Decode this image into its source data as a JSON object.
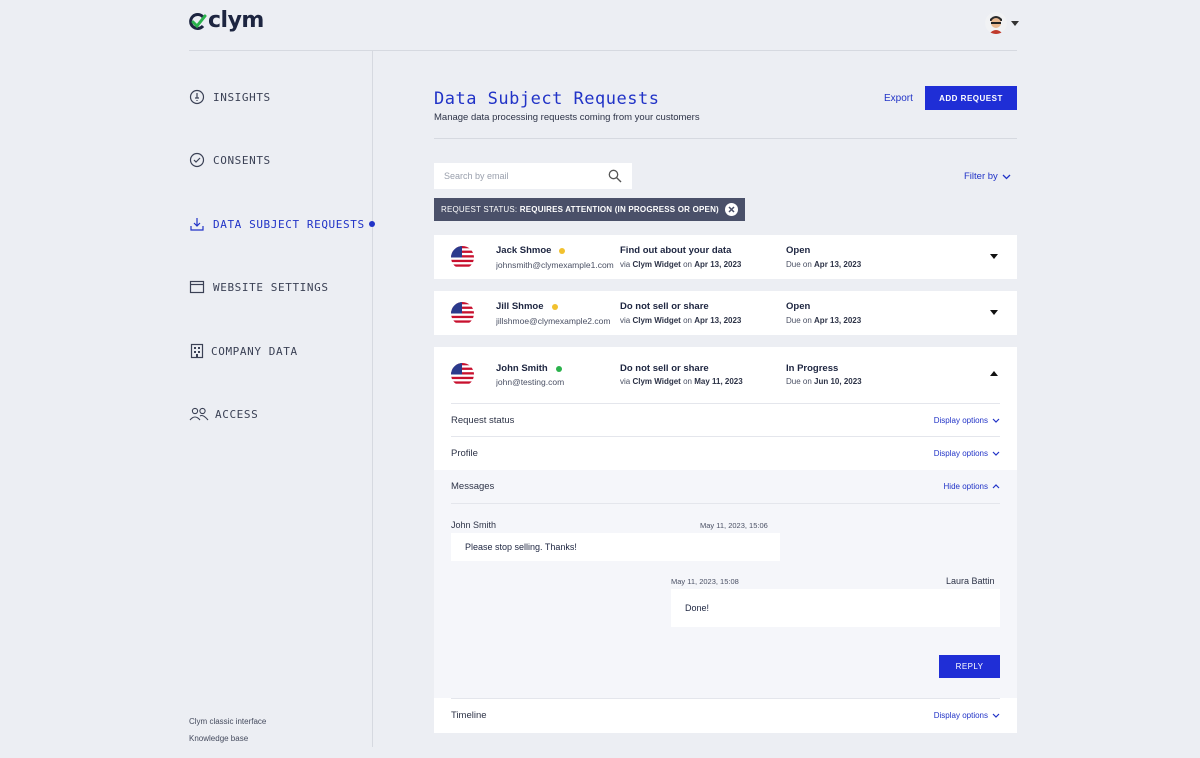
{
  "app": {
    "logo_text": "clym",
    "brand_color": "#1f2ed6"
  },
  "sidebar": {
    "items": [
      {
        "label": "INSIGHTS",
        "icon": "insights-icon"
      },
      {
        "label": "CONSENTS",
        "icon": "check-circle-icon"
      },
      {
        "label": "DATA SUBJECT REQUESTS",
        "icon": "download-icon",
        "active": true
      },
      {
        "label": "WEBSITE SETTINGS",
        "icon": "browser-window-icon"
      },
      {
        "label": "COMPANY DATA",
        "icon": "building-icon"
      },
      {
        "label": "ACCESS",
        "icon": "users-icon"
      }
    ],
    "footer": {
      "classic": "Clym classic interface",
      "kb": "Knowledge base"
    }
  },
  "page": {
    "title": "Data Subject Requests",
    "subtitle": "Manage data processing requests coming from your customers",
    "export_label": "Export",
    "add_label": "ADD REQUEST"
  },
  "search": {
    "placeholder": "Search by email"
  },
  "filter": {
    "label": "Filter by"
  },
  "chip": {
    "prefix": "REQUEST STATUS:",
    "value": "REQUIRES ATTENTION (IN PROGRESS OR OPEN)"
  },
  "requests": [
    {
      "name": "Jack Shmoe",
      "dot_color": "#f2c12e",
      "email": "johnsmith@clymexample1.com",
      "type": "Find out about your data",
      "via_prefix": "via",
      "via": "Clym Widget",
      "on": "on",
      "date": "Apr 13, 2023",
      "status": "Open",
      "due_prefix": "Due on",
      "due": "Apr 13, 2023"
    },
    {
      "name": "Jill Shmoe",
      "dot_color": "#f2c12e",
      "email": "jillshmoe@clymexample2.com",
      "type": "Do not sell or share",
      "via_prefix": "via",
      "via": "Clym Widget",
      "on": "on",
      "date": "Apr 13, 2023",
      "status": "Open",
      "due_prefix": "Due on",
      "due": "Apr 13, 2023"
    },
    {
      "name": "John Smith",
      "dot_color": "#2bb24c",
      "email": "john@testing.com",
      "type": "Do not sell or share",
      "via_prefix": "via",
      "via": "Clym Widget",
      "on": "on",
      "date": "May 11, 2023",
      "status": "In Progress",
      "due_prefix": "Due on",
      "due": "Jun 10, 2023"
    }
  ],
  "details": {
    "request_status": {
      "label": "Request status",
      "action": "Display options"
    },
    "profile": {
      "label": "Profile",
      "action": "Display options"
    },
    "messages": {
      "label": "Messages",
      "action": "Hide options"
    },
    "timeline": {
      "label": "Timeline",
      "action": "Display options"
    }
  },
  "messages": [
    {
      "author": "John Smith",
      "time": "May 11, 2023, 15:06",
      "text": "Please stop selling. Thanks!"
    },
    {
      "author": "Laura Battin",
      "time": "May 11, 2023, 15:08",
      "text": "Done!"
    }
  ],
  "reply_label": "REPLY"
}
